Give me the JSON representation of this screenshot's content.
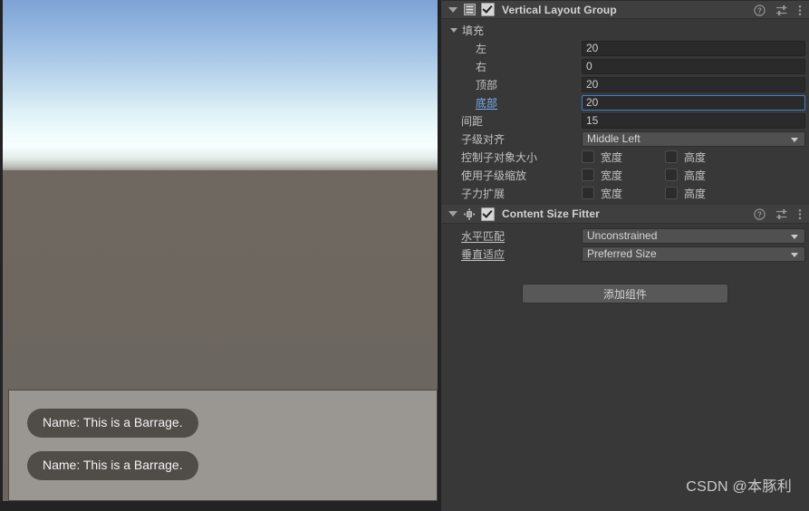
{
  "game_view": {
    "overlay_panel": {
      "barrages": [
        {
          "text": "Name: This is a Barrage."
        },
        {
          "text": "Name: This is a Barrage."
        }
      ]
    }
  },
  "inspector": {
    "components": [
      {
        "title": "Vertical Layout Group",
        "icon": "layout-group-icon",
        "enabled": true,
        "header_icons": [
          "help-icon",
          "preset-icon",
          "more-menu-icon"
        ],
        "groups": [
          {
            "label": "填充",
            "expanded": true,
            "rows": [
              {
                "label": "左",
                "type": "field",
                "value": "20",
                "focused": false
              },
              {
                "label": "右",
                "type": "field",
                "value": "0",
                "focused": false
              },
              {
                "label": "顶部",
                "type": "field",
                "value": "20",
                "focused": false
              },
              {
                "label": "底部",
                "type": "field",
                "value": "20",
                "focused": true
              }
            ]
          }
        ],
        "rows": [
          {
            "label": "间距",
            "type": "field",
            "value": "15"
          },
          {
            "label": "子级对齐",
            "type": "dropdown",
            "value": "Middle Left"
          },
          {
            "label": "控制子对象大小",
            "type": "checks",
            "checks": [
              {
                "label": "宽度",
                "checked": false
              },
              {
                "label": "高度",
                "checked": false
              }
            ]
          },
          {
            "label": "使用子级缩放",
            "type": "checks",
            "checks": [
              {
                "label": "宽度",
                "checked": false
              },
              {
                "label": "高度",
                "checked": false
              }
            ]
          },
          {
            "label": "子力扩展",
            "type": "checks",
            "checks": [
              {
                "label": "宽度",
                "checked": false
              },
              {
                "label": "高度",
                "checked": false
              }
            ]
          }
        ]
      },
      {
        "title": "Content Size Fitter",
        "icon": "content-size-fitter-icon",
        "enabled": true,
        "header_icons": [
          "help-icon",
          "preset-icon",
          "more-menu-icon"
        ],
        "rows": [
          {
            "label": "水平匹配",
            "type": "dropdown",
            "value": "Unconstrained",
            "underlined": true
          },
          {
            "label": "垂直适应",
            "type": "dropdown",
            "value": "Preferred Size",
            "underlined": true
          }
        ]
      }
    ],
    "add_component_label": "添加组件"
  },
  "watermark": "CSDN @本豚利",
  "colors": {
    "panel_bg": "#383838",
    "header_bg": "#3f3f3f",
    "field_bg": "#2a2a2a",
    "dropdown_bg": "#505050",
    "focus_blue": "#3f7fd0",
    "label_blue": "#7bafe8",
    "overlay_panel": "#9a9691",
    "bubble_bg": "#504c48"
  }
}
